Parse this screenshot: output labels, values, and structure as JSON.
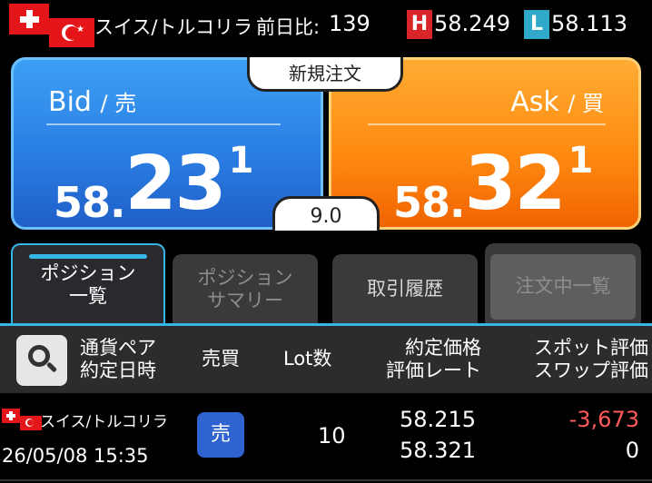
{
  "header": {
    "pair": "スイス/トルコリラ",
    "diff_label": "前日比:",
    "diff_value": "139",
    "high_badge": "H",
    "high_value": "58.249",
    "low_badge": "L",
    "low_value": "58.113",
    "colors": {
      "high": "#d7252a",
      "low": "#2fa8c9"
    }
  },
  "bid": {
    "title": "Bid",
    "title_jp": "/ 売",
    "price_prefix": "58.",
    "price_big": "23",
    "price_sup": "1"
  },
  "ask": {
    "title": "Ask",
    "title_jp": "/ 買",
    "price_prefix": "58.",
    "price_big": "32",
    "price_sup": "1"
  },
  "new_order_label": "新規注文",
  "spread": "9.0",
  "tabs": [
    {
      "line1": "ポジション",
      "line2": "一覧"
    },
    {
      "line1": "ポジション",
      "line2": "サマリー"
    },
    {
      "line1": "取引履歴",
      "line2": ""
    },
    {
      "line1": "注文中一覧",
      "line2": ""
    }
  ],
  "table_header": {
    "pair_line1": "通貨ペア",
    "pair_line2": "約定日時",
    "side": "売買",
    "lot": "Lot数",
    "price_line1": "約定価格",
    "price_line2": "評価レート",
    "eval_line1": "スポット評価",
    "eval_line2": "スワップ評価"
  },
  "rows": [
    {
      "pair": "スイス/トルコリラ",
      "datetime": "26/05/08 15:35",
      "side": "売",
      "lot": "10",
      "exec_price": "58.215",
      "eval_rate": "58.321",
      "spot_eval": "-3,673",
      "swap_eval": "0"
    }
  ]
}
